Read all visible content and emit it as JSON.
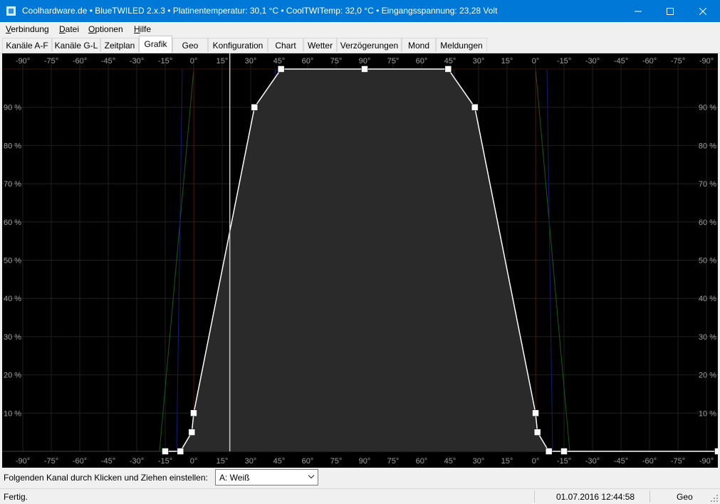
{
  "window": {
    "title": "Coolhardware.de • BlueTWILED 2.x.3 • Platinentemperatur: 30,1 °C • CoolTWITemp: 32,0 °C • Eingangsspannung: 23,28 Volt",
    "controls": [
      "minimize-icon",
      "maximize-icon",
      "close-icon"
    ]
  },
  "menu": {
    "items": [
      {
        "first": "V",
        "rest": "erbindung"
      },
      {
        "first": "D",
        "rest": "atei"
      },
      {
        "first": "O",
        "rest": "ptionen"
      },
      {
        "first": "H",
        "rest": "ilfe"
      }
    ]
  },
  "tabs": [
    "Kanäle A-F",
    "Kanäle G-L",
    "Zeitplan",
    "Grafik",
    "Geo",
    "Konfiguration",
    "Chart",
    "Wetter",
    "Verzögerungen",
    "Mond",
    "Meldungen"
  ],
  "active_tab": "Grafik",
  "chart_data": {
    "type": "line",
    "x_tick_labels": [
      "-90°",
      "-75°",
      "-60°",
      "-45°",
      "-30°",
      "-15°",
      "0°",
      "15°",
      "30°",
      "45°",
      "60°",
      "75°",
      "90°",
      "75°",
      "60°",
      "45°",
      "30°",
      "15°",
      "0°",
      "-15°",
      "-30°",
      "-45°",
      "-60°",
      "-75°",
      "-90°"
    ],
    "y_tick_labels": [
      "10 %",
      "20 %",
      "30 %",
      "40 %",
      "50 %",
      "60 %",
      "70 %",
      "80 %",
      "90 %"
    ],
    "ylim": [
      0,
      100
    ],
    "sun_path_degrees_span": 360,
    "series": [
      {
        "color": "#ffffff",
        "x": [
          -15,
          -7,
          -1,
          0,
          32,
          46,
          90,
          134,
          148,
          180,
          181,
          187,
          195,
          276
        ],
        "y": [
          0,
          0,
          5,
          10,
          90,
          100,
          100,
          100,
          90,
          10,
          5,
          0,
          0,
          0
        ]
      }
    ],
    "current_position_deg": 19
  },
  "channel_selector": {
    "label": "Folgenden Kanal durch Klicken und Ziehen einstellen:",
    "value": "A: Weiß"
  },
  "status": {
    "left": "Fertig.",
    "datetime": "01.07.2016 12:44:58",
    "mode": "Geo"
  }
}
